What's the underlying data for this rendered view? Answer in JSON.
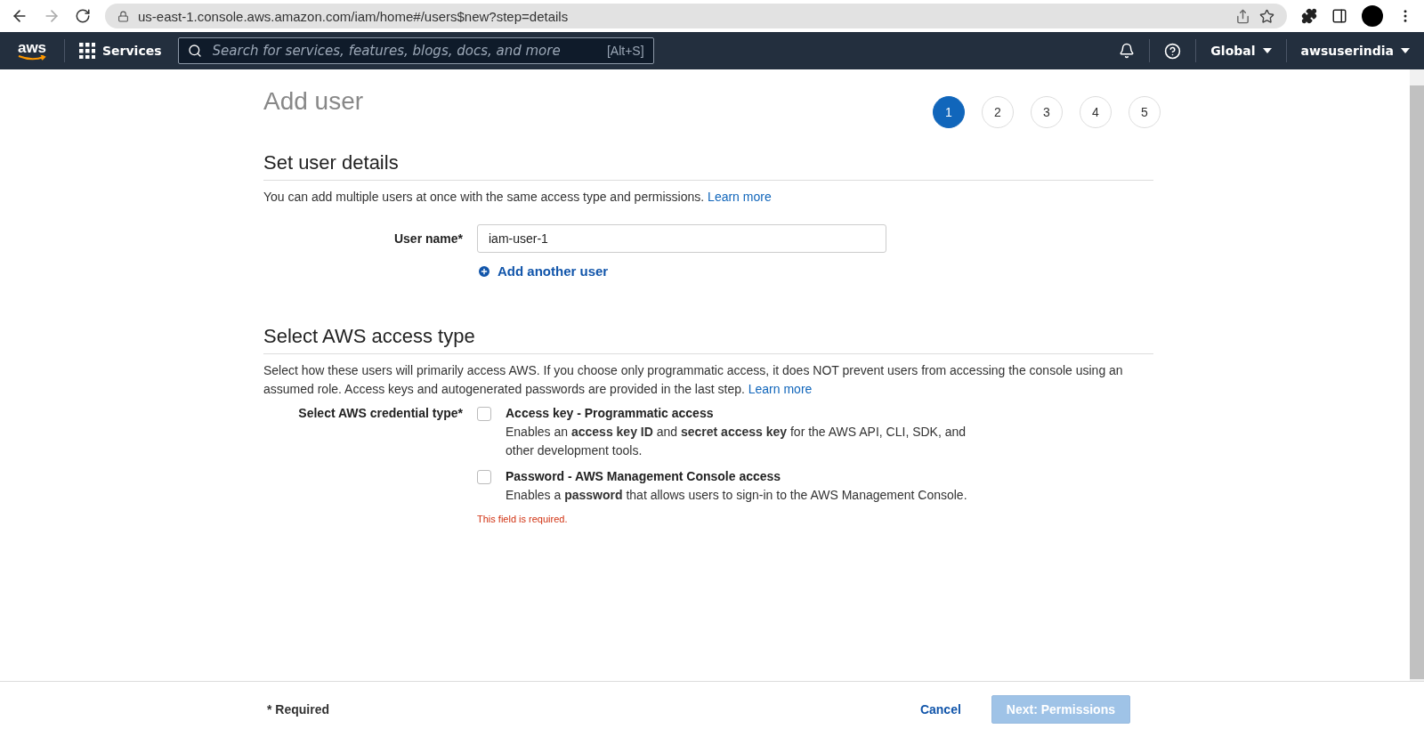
{
  "browser": {
    "url": "us-east-1.console.aws.amazon.com/iam/home#/users$new?step=details"
  },
  "nav": {
    "logo": "aws",
    "services": "Services",
    "search_placeholder": "Search for services, features, blogs, docs, and more",
    "search_shortcut": "[Alt+S]",
    "region": "Global",
    "account": "awsuserindia"
  },
  "page": {
    "title": "Add user",
    "steps": [
      {
        "label": "1",
        "selected": true
      },
      {
        "label": "2",
        "selected": false
      },
      {
        "label": "3",
        "selected": false
      },
      {
        "label": "4",
        "selected": false
      },
      {
        "label": "5",
        "selected": false
      }
    ],
    "details": {
      "heading": "Set user details",
      "description": "You can add multiple users at once with the same access type and permissions.",
      "learn_more": "Learn more",
      "user_name_label": "User name*",
      "user_name_value": "iam-user-1",
      "add_another": "Add another user"
    },
    "access": {
      "heading": "Select AWS access type",
      "description": "Select how these users will primarily access AWS. If you choose only programmatic access, it does NOT prevent users from accessing the console using an assumed role. Access keys and autogenerated passwords are provided in the last step.",
      "learn_more": "Learn more",
      "credential_label": "Select AWS credential type*",
      "options": [
        {
          "title": "Access key - Programmatic access",
          "description": "Enables an **access key ID** and **secret access key** for the AWS API, CLI, SDK, and other development tools.",
          "checked": false
        },
        {
          "title": "Password - AWS Management Console access",
          "description": "Enables a **password** that allows users to sign-in to the AWS Management Console.",
          "checked": false
        }
      ],
      "error": "This field is required."
    }
  },
  "footer": {
    "required": "* Required",
    "cancel": "Cancel",
    "next": "Next: Permissions",
    "next_disabled": true
  }
}
